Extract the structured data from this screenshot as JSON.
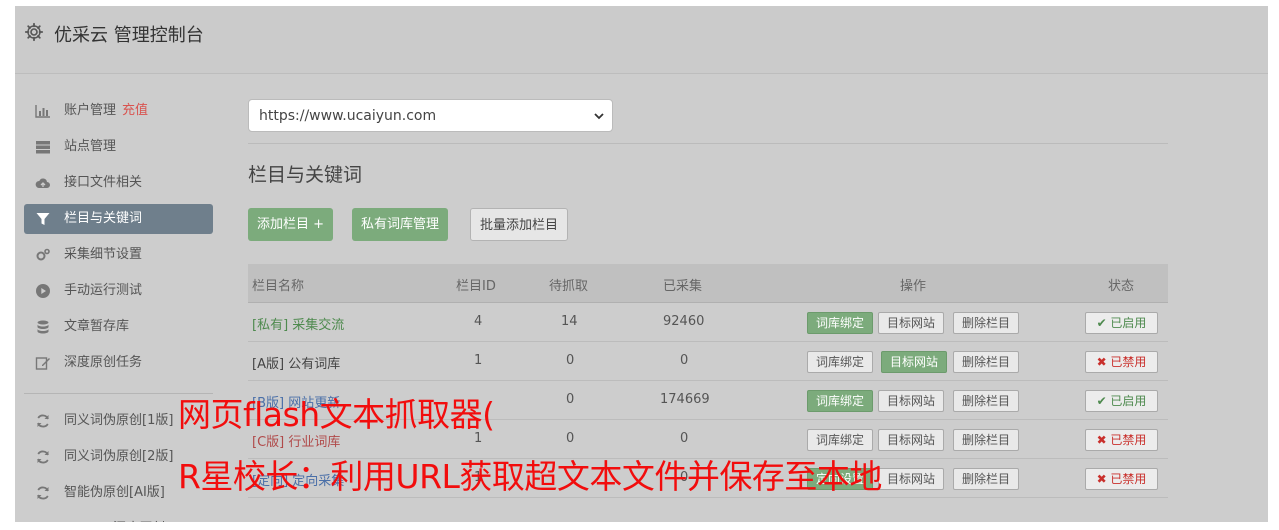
{
  "header": {
    "title": "优采云 管理控制台"
  },
  "sidebar": {
    "items": [
      {
        "label": "账户管理",
        "badge": "充值",
        "icon": "bar-chart-icon"
      },
      {
        "label": "站点管理",
        "icon": "server-icon"
      },
      {
        "label": "接口文件相关",
        "icon": "cloud-upload-icon"
      },
      {
        "label": "栏目与关键词",
        "icon": "filter-icon",
        "active": true
      },
      {
        "label": "采集细节设置",
        "icon": "cogs-icon"
      },
      {
        "label": "手动运行测试",
        "icon": "play-circle-icon"
      },
      {
        "label": "文章暂存库",
        "icon": "database-icon"
      },
      {
        "label": "深度原创任务",
        "icon": "edit-icon"
      }
    ],
    "items2": [
      {
        "label": "同义词伪原创[1版]",
        "icon": "refresh-icon"
      },
      {
        "label": "同义词伪原创[2版]",
        "icon": "refresh-icon"
      },
      {
        "label": "智能伪原创[AI版]",
        "icon": "refresh-icon"
      },
      {
        "label": "UWriter深度原创",
        "icon": "edit-icon"
      }
    ]
  },
  "main": {
    "site_select": {
      "value": "https://www.ucaiyun.com"
    },
    "section_title": "栏目与关键词",
    "buttons": {
      "add_column": "添加栏目 +",
      "private_lib": "私有词库管理",
      "batch_add": "批量添加栏目"
    },
    "table": {
      "headers": {
        "name": "栏目名称",
        "id": "栏目ID",
        "pending": "待抓取",
        "collected": "已采集",
        "ops": "操作",
        "status": "状态"
      },
      "ops_labels": {
        "bind": "词库绑定",
        "target": "目标网站",
        "delete": "删除栏目"
      },
      "rows": [
        {
          "tag": "[私有]",
          "name": "采集交流",
          "id": "4",
          "pending": "14",
          "collected": "92460",
          "status": "✔ 已启用"
        },
        {
          "tag": "[A版]",
          "name": "公有词库",
          "id": "1",
          "pending": "0",
          "collected": "0",
          "status": "✖ 已禁用"
        },
        {
          "tag": "[B版]",
          "name": "网站更新",
          "id": "",
          "pending": "0",
          "collected": "174669",
          "status": "✔ 已启用"
        },
        {
          "tag": "[C版]",
          "name": "行业词库",
          "id": "1",
          "pending": "0",
          "collected": "0",
          "status": "✖ 已禁用"
        },
        {
          "tag": "[定向]",
          "name": "定向采集",
          "id": "1",
          "pending": "",
          "collected": "0",
          "op_bind": "定向设置",
          "status": "✖ 已禁用"
        }
      ]
    }
  },
  "overlay": {
    "line1": "网页flash文本抓取器(",
    "line2": "R星校长：利用URL获取超文本文件并保存至本地"
  },
  "colors": {
    "accent_green": "#7cab7c",
    "active_nav": "#6f7f8c",
    "danger": "#d9534f",
    "overlay_red": "#f20d0d"
  }
}
